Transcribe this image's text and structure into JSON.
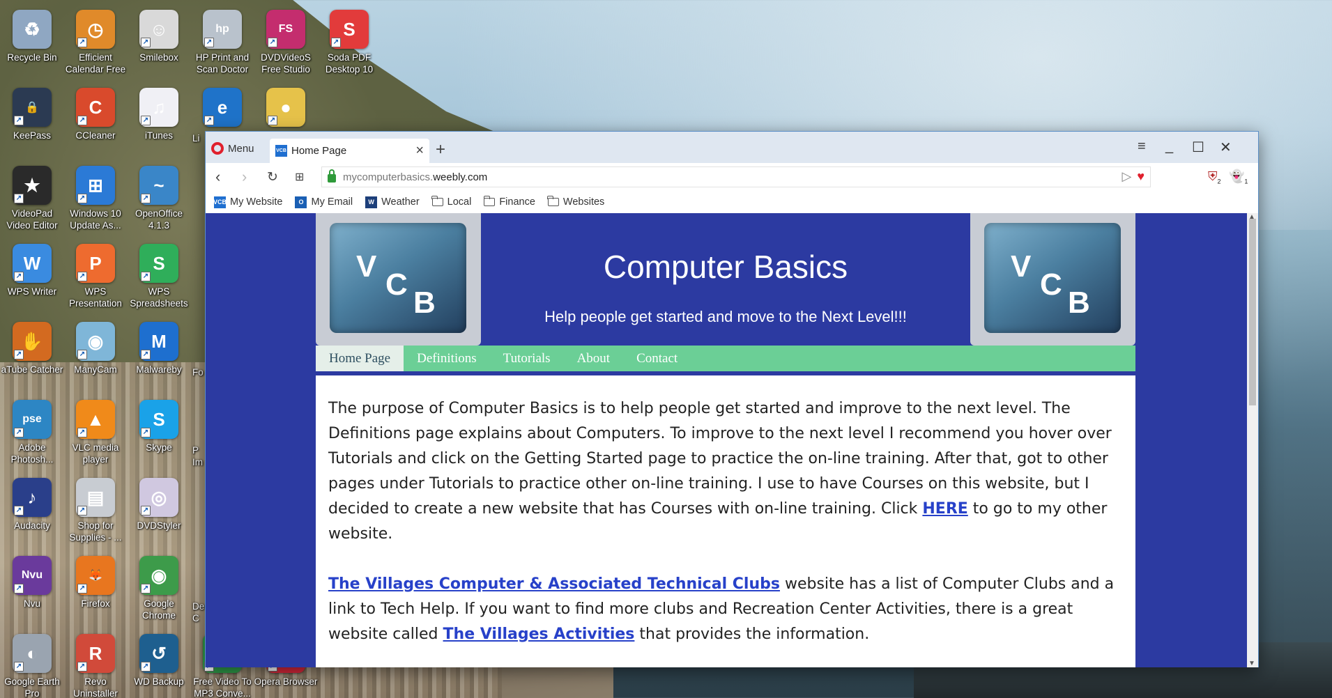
{
  "desktop": {
    "icons": [
      {
        "label": "Recycle Bin",
        "icon": "recycle-bin-icon",
        "color": "#8fa7c2",
        "glyph": "♻"
      },
      {
        "label": "Efficient Calendar Free",
        "icon": "calendar-clock-icon",
        "color": "#e08a2a",
        "glyph": "◷"
      },
      {
        "label": "Smilebox",
        "icon": "smilebox-icon",
        "color": "#d9d9d9",
        "glyph": "☺"
      },
      {
        "label": "HP Print and Scan Doctor",
        "icon": "hp-printer-icon",
        "color": "#b9c2cc",
        "glyph": "hp"
      },
      {
        "label": "DVDVideoS Free Studio",
        "icon": "fs-studio-icon",
        "color": "#c42d6e",
        "glyph": "FS"
      },
      {
        "label": "Soda PDF Desktop 10",
        "icon": "soda-pdf-icon",
        "color": "#e23b3b",
        "glyph": "S"
      },
      {
        "label": "KeePass",
        "icon": "keepass-lock-icon",
        "color": "#2b3a52",
        "glyph": "🔒"
      },
      {
        "label": "CCleaner",
        "icon": "ccleaner-icon",
        "color": "#d94a2c",
        "glyph": "C"
      },
      {
        "label": "iTunes",
        "icon": "itunes-icon",
        "color": "#f0f0f5",
        "glyph": "♫"
      },
      {
        "label": "",
        "icon": "edge-icon",
        "color": "#1f73c9",
        "glyph": "e"
      },
      {
        "label": "",
        "icon": "paint-palette-icon",
        "color": "#e6c24a",
        "glyph": "●"
      },
      {
        "label": "VideoPad Video Editor",
        "icon": "videopad-icon",
        "color": "#2a2a2a",
        "glyph": "★"
      },
      {
        "label": "Windows 10 Update As...",
        "icon": "windows-update-icon",
        "color": "#2b7ad6",
        "glyph": "⊞"
      },
      {
        "label": "OpenOffice 4.1.3",
        "icon": "openoffice-icon",
        "color": "#3a86c8",
        "glyph": "~"
      },
      {
        "label": "WPS Writer",
        "icon": "wps-writer-icon",
        "color": "#3a8be0",
        "glyph": "W"
      },
      {
        "label": "WPS Presentation",
        "icon": "wps-presentation-icon",
        "color": "#ee6b2f",
        "glyph": "P"
      },
      {
        "label": "WPS Spreadsheets",
        "icon": "wps-spreadsheets-icon",
        "color": "#2fae5a",
        "glyph": "S"
      },
      {
        "label": "aTube Catcher",
        "icon": "atube-catcher-icon",
        "color": "#d36a20",
        "glyph": "✋"
      },
      {
        "label": "ManyCam",
        "icon": "manycam-icon",
        "color": "#7fb6d8",
        "glyph": "◉"
      },
      {
        "label": "Malwareby",
        "icon": "malwarebytes-icon",
        "color": "#1e6fcf",
        "glyph": "M"
      },
      {
        "label": "Adobe Photosh...",
        "icon": "photoshop-icon",
        "color": "#2d86c4",
        "glyph": "pse"
      },
      {
        "label": "VLC media player",
        "icon": "vlc-cone-icon",
        "color": "#f08a1a",
        "glyph": "▲"
      },
      {
        "label": "Skype",
        "icon": "skype-icon",
        "color": "#1aa2e8",
        "glyph": "S"
      },
      {
        "label": "Audacity",
        "icon": "audacity-headphones-icon",
        "color": "#2a3f8a",
        "glyph": "♪"
      },
      {
        "label": "Shop for Supplies - ...",
        "icon": "printer-supplies-icon",
        "color": "#c8ccd2",
        "glyph": "▤"
      },
      {
        "label": "DVDStyler",
        "icon": "dvdstyler-icon",
        "color": "#d0c8e0",
        "glyph": "◎"
      },
      {
        "label": "Nvu",
        "icon": "nvu-icon",
        "color": "#6a3a9c",
        "glyph": "Nvu"
      },
      {
        "label": "Firefox",
        "icon": "firefox-icon",
        "color": "#e8761f",
        "glyph": "🦊"
      },
      {
        "label": "Google Chrome",
        "icon": "chrome-icon",
        "color": "#3d9b4a",
        "glyph": "◉"
      },
      {
        "label": "Google Earth Pro",
        "icon": "google-earth-icon",
        "color": "#9aa4b0",
        "glyph": "◐"
      },
      {
        "label": "Revo Uninstaller",
        "icon": "revo-uninstaller-icon",
        "color": "#d14a3a",
        "glyph": "R"
      },
      {
        "label": "WD Backup",
        "icon": "wd-backup-icon",
        "color": "#1e5f8f",
        "glyph": "↺"
      },
      {
        "label": "Free Video To MP3 Conve...",
        "icon": "video-to-mp3-icon",
        "color": "#2f9c4a",
        "glyph": "♪"
      },
      {
        "label": "Opera Browser",
        "icon": "opera-icon",
        "color": "#d9283a",
        "glyph": "O"
      }
    ],
    "partial_labels": [
      "Li",
      "Fo",
      "P Im",
      "De C"
    ]
  },
  "browser": {
    "menu_label": "Menu",
    "tab_title": "Home Page",
    "tab_favicon": "VCB",
    "new_tab": "+",
    "url_path": "mycomputerbasics.",
    "url_host": "weebly.com",
    "bookmarks": [
      {
        "label": "My Website",
        "icon": "vcb-favicon-icon",
        "color": "#1f6fd0",
        "glyph": "VCB"
      },
      {
        "label": "My Email",
        "icon": "outlook-icon",
        "color": "#1a5fb4",
        "glyph": "O"
      },
      {
        "label": "Weather",
        "icon": "weather-icon",
        "color": "#1d3f7a",
        "glyph": "W"
      },
      {
        "label": "Local",
        "icon": "folder-icon"
      },
      {
        "label": "Finance",
        "icon": "folder-icon"
      },
      {
        "label": "Websites",
        "icon": "folder-icon"
      }
    ],
    "ext_badges": {
      "ublock": "2",
      "ghostery": "1"
    }
  },
  "site": {
    "title": "Computer Basics",
    "subtitle": "Help people get started and move to the Next Level!!!",
    "logo": {
      "v": "V",
      "c": "C",
      "b": "B"
    },
    "nav": [
      "Home Page",
      "Definitions",
      "Tutorials",
      "About",
      "Contact"
    ],
    "para1_text": "The purpose of Computer Basics is to help people get started and improve to the next level. The Definitions page explains about Computers.  To improve to the next level I recommend you hover over Tutorials and click on the Getting Started page to practice the on-line training.  After that, got to other pages under Tutorials to practice other on-line training.  I use to have Courses on this website, but I decided to create a new website that has Courses with on-line training.  Click ",
    "para1_link": "HERE",
    "para1_tail": " to go to my other website.",
    "para2_link1": "The Villages Computer & Associated Technical Clubs",
    "para2_text": " website has a list of Computer Clubs and a link to Tech Help.  If you want to find more clubs and Recreation Center Activities, there is a great website called ",
    "para2_link2": "The Villages Activities",
    "para2_tail": " that provides the information."
  },
  "colors": {
    "site_blue": "#2c3aa1",
    "nav_green": "#6bcf96",
    "link_blue": "#2741c9"
  }
}
